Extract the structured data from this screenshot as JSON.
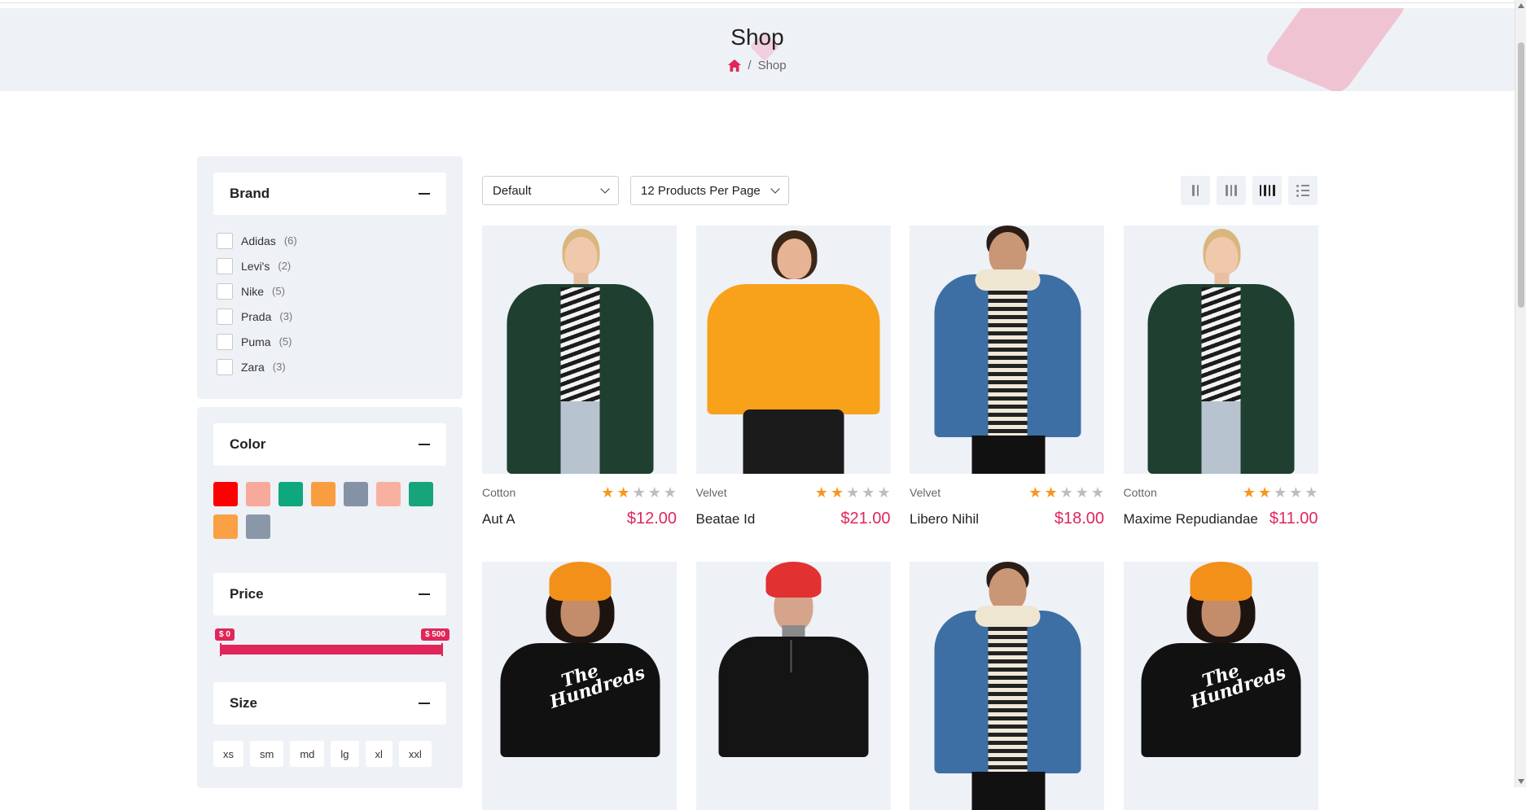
{
  "page": {
    "title": "Shop",
    "breadcrumb": {
      "home_icon": "home-icon",
      "separator": "/",
      "current": "Shop"
    }
  },
  "colors": {
    "accent": "#e0265a",
    "star": "#f7961d",
    "panel_bg": "#eef1f6"
  },
  "filters": {
    "brand": {
      "title": "Brand",
      "items": [
        {
          "label": "Adidas",
          "count": "(6)"
        },
        {
          "label": "Levi's",
          "count": "(2)"
        },
        {
          "label": "Nike",
          "count": "(5)"
        },
        {
          "label": "Prada",
          "count": "(3)"
        },
        {
          "label": "Puma",
          "count": "(5)"
        },
        {
          "label": "Zara",
          "count": "(3)"
        }
      ]
    },
    "color": {
      "title": "Color",
      "swatches": [
        "#ff0000",
        "#f8a99b",
        "#0fa77d",
        "#f99d41",
        "#8492a6",
        "#f8b1a0",
        "#16a57b",
        "#f9a144",
        "#8a97a8"
      ]
    },
    "price": {
      "title": "Price",
      "min_label": "$ 0",
      "max_label": "$ 500"
    },
    "size": {
      "title": "Size",
      "options": [
        "xs",
        "sm",
        "md",
        "lg",
        "xl",
        "xxl"
      ]
    }
  },
  "toolbar": {
    "sort": "Default",
    "per_page": "12 Products Per Page",
    "views": [
      "grid-2-icon",
      "grid-3-icon",
      "grid-4-icon",
      "list-icon"
    ],
    "active_view": "grid-4-icon"
  },
  "products": [
    {
      "category": "Cotton",
      "name": "Aut A",
      "price": "$12.00",
      "rating": 2
    },
    {
      "category": "Velvet",
      "name": "Beatae Id",
      "price": "$21.00",
      "rating": 2
    },
    {
      "category": "Velvet",
      "name": "Libero Nihil",
      "price": "$18.00",
      "rating": 2
    },
    {
      "category": "Cotton",
      "name": "Maxime Repudiandae",
      "price": "$11.00",
      "rating": 2
    },
    {
      "category": "",
      "name": "",
      "price": "",
      "rating": 0
    },
    {
      "category": "",
      "name": "",
      "price": "",
      "rating": 0
    },
    {
      "category": "",
      "name": "",
      "price": "",
      "rating": 0
    },
    {
      "category": "",
      "name": "",
      "price": "",
      "rating": 0
    }
  ],
  "print_text": "The Hundreds"
}
